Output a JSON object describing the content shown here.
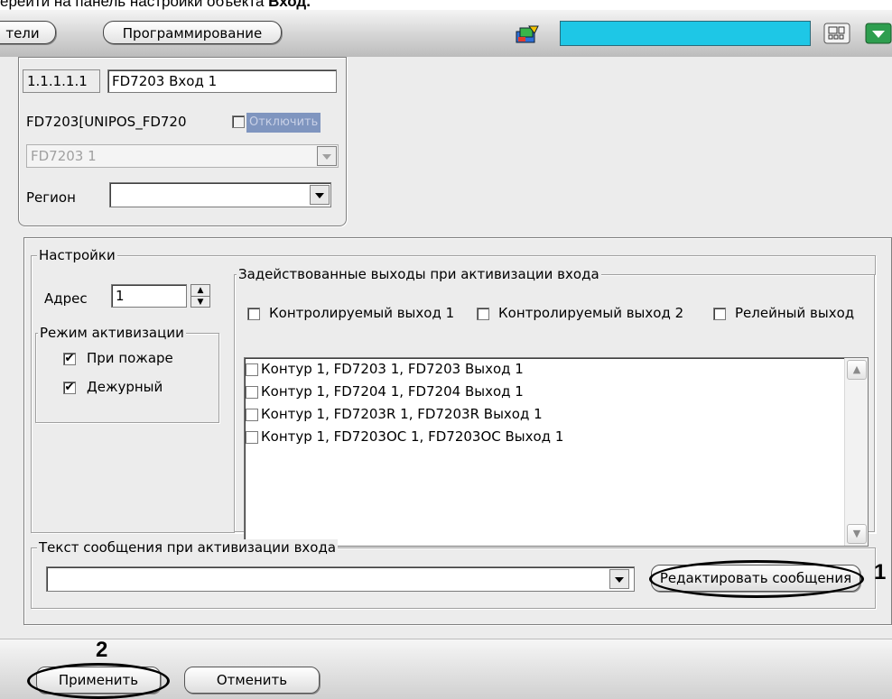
{
  "caption": {
    "text_normal": "ерейти на панель настройки объекта ",
    "text_bold": "Вход."
  },
  "topbar": {
    "tab_left_label": "тели",
    "tab_programming_label": "Программирование",
    "search_value": "",
    "icons": [
      "user-shapes-icon",
      "layout-grid-icon",
      "green-dropdown-icon"
    ],
    "accent_color": "#1ec7e6"
  },
  "object": {
    "id": "1.1.1.1.1",
    "name": "FD7203 Вход 1",
    "parent": "FD7203[UNIPOS_FD720",
    "disable_label": "Отключить",
    "device_select": "FD7203 1",
    "region_label": "Регион",
    "region_value": ""
  },
  "settings": {
    "group_label": "Настройки",
    "address_label": "Адрес",
    "address_value": "1",
    "activation_mode": {
      "label": "Режим активизации",
      "on_fire_label": "При пожаре",
      "on_fire_checked": true,
      "duty_label": "Дежурный",
      "duty_checked": true
    },
    "outputs": {
      "label": "Задействованные выходы при активизации входа",
      "controlled_1": "Контролируемый выход 1",
      "controlled_2": "Контролируемый выход 2",
      "relay": "Релейный выход",
      "items": [
        "Контур 1, FD7203 1, FD7203 Выход 1",
        "Контур 1, FD7204 1, FD7204 Выход 1",
        "Контур 1, FD7203R 1, FD7203R Выход 1",
        "Контур 1, FD7203OC 1, FD7203OC Выход 1"
      ]
    }
  },
  "message": {
    "label": "Текст сообщения при активизации входа",
    "value": "",
    "edit_button": "Редактировать сообщения",
    "marker": "1"
  },
  "footer": {
    "apply_button": "Применить",
    "cancel_button": "Отменить",
    "marker": "2"
  }
}
